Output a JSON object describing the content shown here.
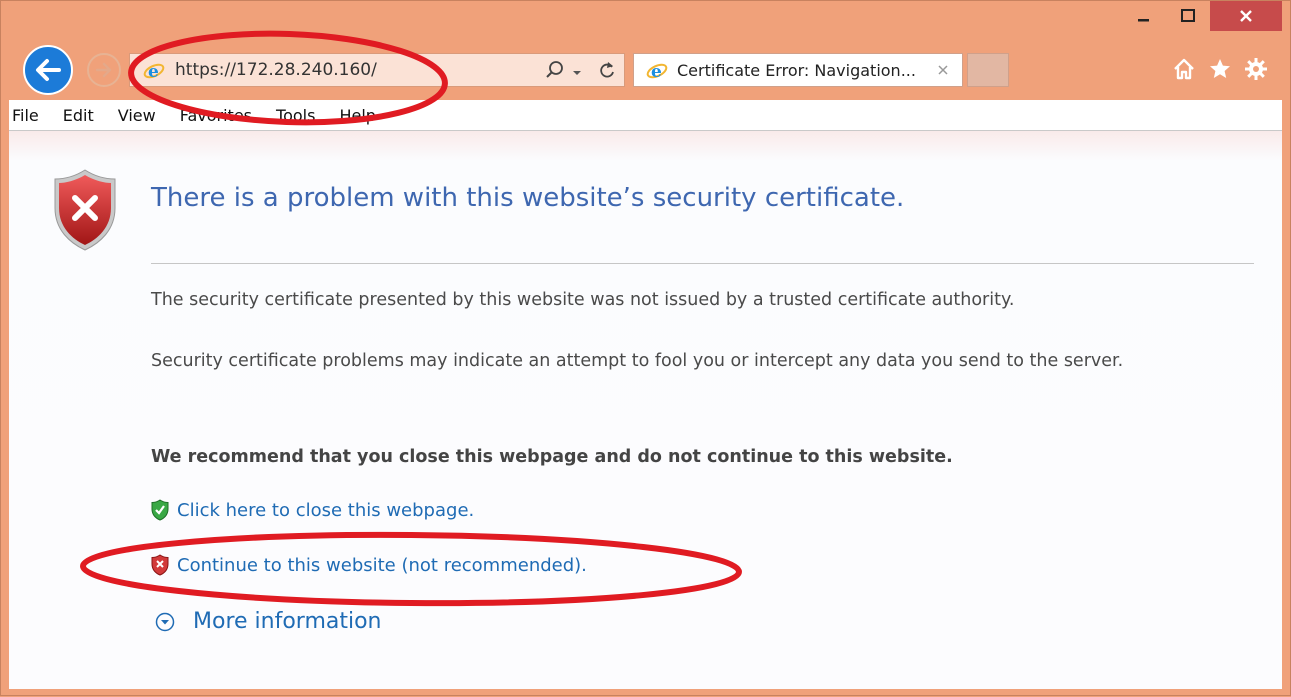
{
  "address_bar": {
    "url_value": "https://172.28.240.160/"
  },
  "tab": {
    "label": "Certificate Error: Navigation..."
  },
  "menu": {
    "items": [
      {
        "id": "file",
        "label": "File"
      },
      {
        "id": "edit",
        "label": "Edit"
      },
      {
        "id": "view",
        "label": "View"
      },
      {
        "id": "favorites",
        "label": "Favorites"
      },
      {
        "id": "tools",
        "label": "Tools"
      },
      {
        "id": "help",
        "label": "Help"
      }
    ]
  },
  "page": {
    "heading": "There is a problem with this website’s security certificate.",
    "paragraph1": "The security certificate presented by this website was not issued by a trusted certificate authority.",
    "paragraph2": "Security certificate problems may indicate an attempt to fool you or intercept any data you send to the server.",
    "recommendation": "We recommend that you close this webpage and do not continue to this website.",
    "close_link": "Click here to close this webpage.",
    "continue_link": "Continue to this website (not recommended).",
    "more_info": "More information"
  },
  "icons": {
    "back": "back-arrow-icon",
    "forward": "forward-arrow-icon",
    "search": "search-icon",
    "refresh": "refresh-icon",
    "home": "home-icon",
    "favorites": "star-icon",
    "settings": "gear-icon"
  },
  "colors": {
    "frame": "#f0a17a",
    "heading": "#3e67b0",
    "link": "#1f6bb4",
    "close_button": "#c74b4b",
    "annotation": "#e01b22"
  }
}
